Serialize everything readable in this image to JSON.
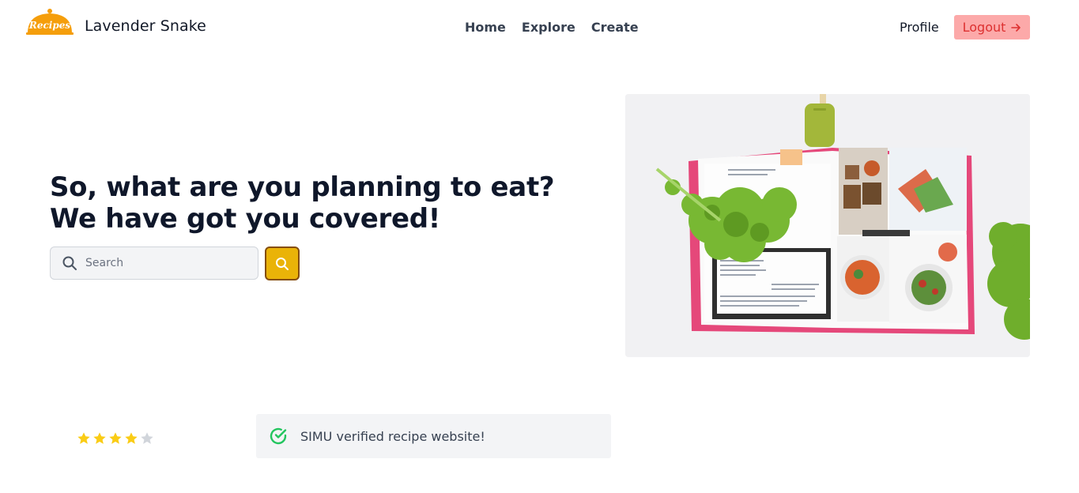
{
  "header": {
    "logo_text": "Recipes",
    "brand": "Lavender Snake",
    "nav": [
      "Home",
      "Explore",
      "Create"
    ],
    "profile": "Profile",
    "logout": "Logout",
    "logout_icon": "arrow-right-icon"
  },
  "hero": {
    "title_line1": "So, what are you planning to eat?",
    "title_line2": "We have got you covered!",
    "search_placeholder": "Search",
    "search_icon": "search-icon",
    "search_button_icon": "search-icon"
  },
  "rating": {
    "value": 4,
    "max": 5,
    "filled_color": "#facc15",
    "empty_color": "#d1d5db"
  },
  "badge": {
    "text": "SIMU verified recipe website!",
    "icon": "check-circle-icon",
    "icon_color": "#22c55e"
  },
  "colors": {
    "accent": "#eab308",
    "logout_bg": "#fca5a5",
    "logout_text": "#dc2626"
  }
}
